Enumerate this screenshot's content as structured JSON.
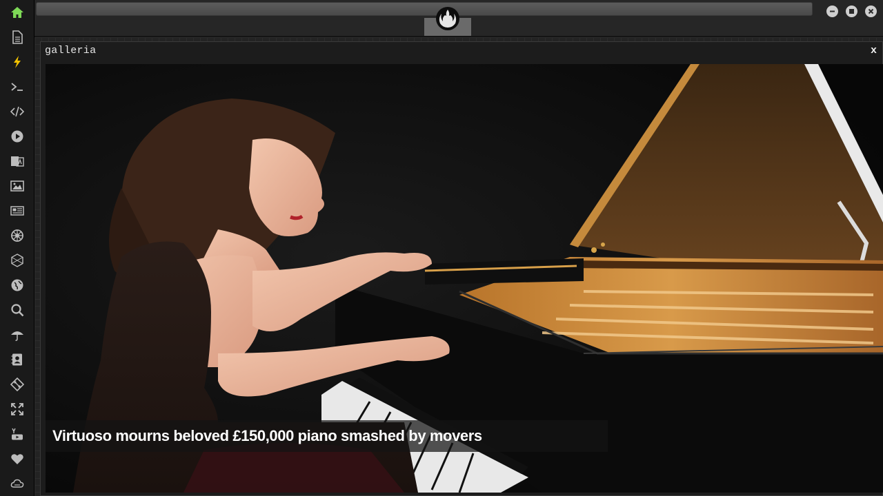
{
  "sidebar": {
    "items": [
      {
        "icon": "home-icon",
        "active": true
      },
      {
        "icon": "document-icon"
      },
      {
        "icon": "lightning-icon"
      },
      {
        "icon": "terminal-icon"
      },
      {
        "icon": "code-icon"
      },
      {
        "icon": "play-icon"
      },
      {
        "icon": "translate-icon"
      },
      {
        "icon": "image-icon"
      },
      {
        "icon": "newspaper-icon"
      },
      {
        "icon": "empire-icon"
      },
      {
        "icon": "cube-icon"
      },
      {
        "icon": "globe-icon"
      },
      {
        "icon": "search-icon"
      },
      {
        "icon": "umbrella-icon"
      },
      {
        "icon": "contacts-icon"
      },
      {
        "icon": "git-icon"
      },
      {
        "icon": "expand-icon"
      },
      {
        "icon": "youtube-icon"
      },
      {
        "icon": "heart-icon"
      },
      {
        "icon": "cloud-icon"
      }
    ],
    "accent_color": "#7ed957"
  },
  "window": {
    "title": "galleria",
    "close_label": "x"
  },
  "gallery": {
    "caption": "Virtuoso mourns beloved £150,000 piano smashed by movers"
  }
}
